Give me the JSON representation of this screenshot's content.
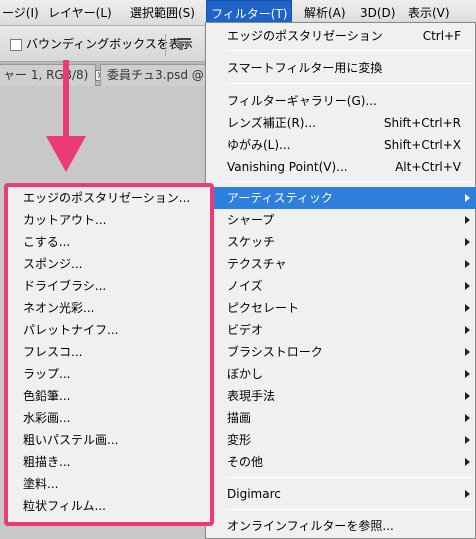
{
  "menubar": {
    "items": [
      {
        "label": "ージ(I)"
      },
      {
        "label": "レイヤー(L)"
      },
      {
        "label": "選択範囲(S)"
      },
      {
        "label": "フィルター(T)"
      },
      {
        "label": "解析(A)"
      },
      {
        "label": "3D(D)"
      },
      {
        "label": "表示(V)"
      }
    ]
  },
  "options": {
    "checkbox_label": "バウンディングボックスを表示"
  },
  "tabs": [
    {
      "label": "ャー 1, RGB/8) ",
      "close": "×"
    },
    {
      "label": "委員チュ3.psd @ ..."
    }
  ],
  "filter_menu": {
    "items": [
      {
        "label": "エッジのポスタリゼーション",
        "shortcut": "Ctrl+F"
      },
      {
        "label": "スマートフィルター用に変換"
      },
      {
        "label": "フィルターギャラリー(G)..."
      },
      {
        "label": "レンズ補正(R)...",
        "shortcut": "Shift+Ctrl+R"
      },
      {
        "label": "ゆがみ(L)...",
        "shortcut": "Shift+Ctrl+X"
      },
      {
        "label": "Vanishing Point(V)...",
        "shortcut": "Alt+Ctrl+V"
      },
      {
        "label": "アーティスティック"
      },
      {
        "label": "シャープ"
      },
      {
        "label": "スケッチ"
      },
      {
        "label": "テクスチャ"
      },
      {
        "label": "ノイズ"
      },
      {
        "label": "ピクセレート"
      },
      {
        "label": "ビデオ"
      },
      {
        "label": "ブラシストローク"
      },
      {
        "label": "ぼかし"
      },
      {
        "label": "表現手法"
      },
      {
        "label": "描画"
      },
      {
        "label": "変形"
      },
      {
        "label": "その他"
      },
      {
        "label": "Digimarc"
      },
      {
        "label": "オンラインフィルターを参照..."
      }
    ]
  },
  "submenu": {
    "items": [
      "エッジのポスタリゼーション...",
      "カットアウト...",
      "こする...",
      "スポンジ...",
      "ドライブラシ...",
      "ネオン光彩...",
      "パレットナイフ...",
      "フレスコ...",
      "ラップ...",
      "色鉛筆...",
      "水彩画...",
      "粗いパステル画...",
      "粗描き...",
      "塗料...",
      "粒状フィルム..."
    ]
  },
  "colors": {
    "highlight": "#2e7fdc",
    "annotation": "#ea3a77"
  }
}
